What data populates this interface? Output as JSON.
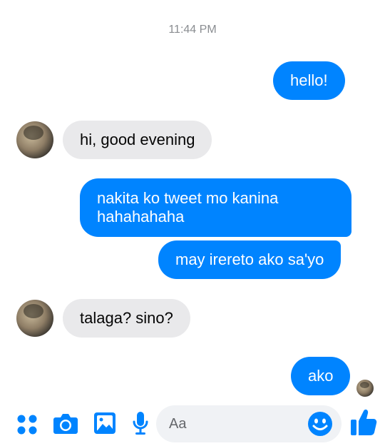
{
  "thread": {
    "timestamp": "11:44 PM",
    "messages": [
      {
        "direction": "outgoing",
        "text": "hello!"
      },
      {
        "direction": "incoming",
        "text": "hi, good evening"
      },
      {
        "direction": "outgoing",
        "text": "nakita ko tweet mo kanina\nhahahahaha"
      },
      {
        "direction": "outgoing",
        "text": "may irereto ako sa'yo"
      },
      {
        "direction": "incoming",
        "text": "talaga? sino?"
      },
      {
        "direction": "outgoing",
        "text": "ako"
      }
    ]
  },
  "composer": {
    "placeholder": "Aa",
    "icons": [
      "apps-icon",
      "camera-icon",
      "gallery-icon",
      "microphone-icon",
      "emoji-icon",
      "thumbs-up-icon"
    ]
  },
  "colors": {
    "accent": "#0084ff",
    "incoming_bubble": "#e9e9eb",
    "composer_bg": "#f0f2f5",
    "timestamp_text": "#8a8d91"
  }
}
